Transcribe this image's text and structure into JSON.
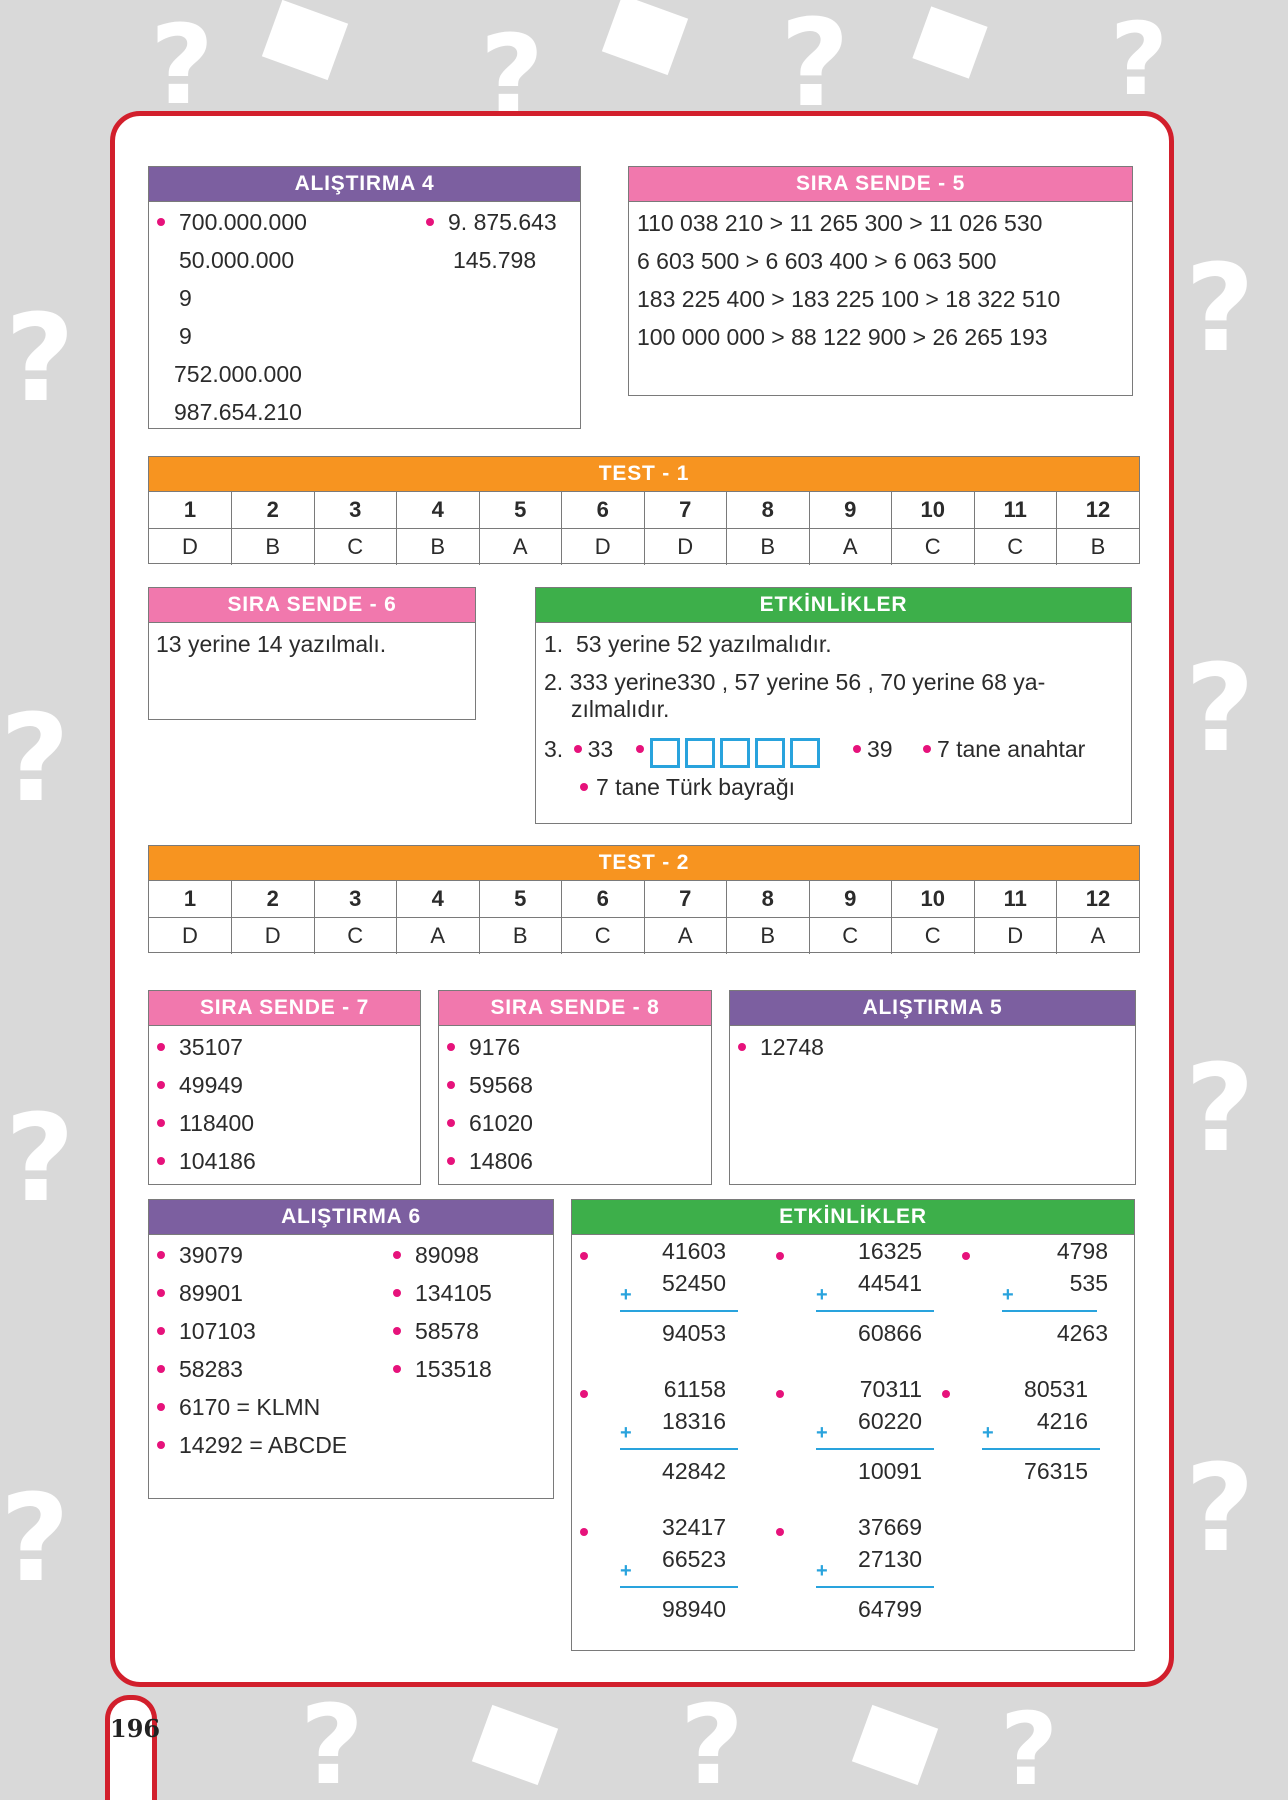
{
  "page_number": "196",
  "alistirma4": {
    "title": "ALIŞTIRMA 4",
    "col1": [
      "700.000.000",
      "50.000.000",
      "9",
      "9",
      "752.000.000",
      "987.654.210"
    ],
    "col2": [
      "9. 875.643",
      "145.798"
    ]
  },
  "sira5": {
    "title": "SIRA SENDE - 5",
    "lines": [
      "110 038 210 > 11 265 300 > 11 026 530",
      "6 603 500 > 6 603 400 > 6 063 500",
      "183 225 400 > 183 225 100 > 18 322 510",
      "100 000 000 > 88 122 900 > 26 265 193"
    ]
  },
  "test1": {
    "title": "TEST - 1",
    "numbers": [
      "1",
      "2",
      "3",
      "4",
      "5",
      "6",
      "7",
      "8",
      "9",
      "10",
      "11",
      "12"
    ],
    "answers": [
      "D",
      "B",
      "C",
      "B",
      "A",
      "D",
      "D",
      "B",
      "A",
      "C",
      "C",
      "B"
    ]
  },
  "sira6": {
    "title": "SIRA SENDE - 6",
    "text": "13 yerine 14 yazılmalı."
  },
  "etkinlikler1": {
    "title": "ETKİNLİKLER",
    "item1_num": "1.",
    "item1": "53 yerine 52 yazılmalıdır.",
    "item2_num": "2.",
    "item2_a": "333 yerine330 ,  57 yerine 56  , 70 yerine 68 ya-",
    "item2_b": "zılmalıdır.",
    "item3_num": "3.",
    "item3_a": "33",
    "item3_c": "39",
    "item3_d": "7 tane anahtar",
    "item3_e": "7 tane Türk bayrağı"
  },
  "test2": {
    "title": "TEST - 2",
    "numbers": [
      "1",
      "2",
      "3",
      "4",
      "5",
      "6",
      "7",
      "8",
      "9",
      "10",
      "11",
      "12"
    ],
    "answers": [
      "D",
      "D",
      "C",
      "A",
      "B",
      "C",
      "A",
      "B",
      "C",
      "C",
      "D",
      "A"
    ]
  },
  "sira7": {
    "title": "SIRA SENDE - 7",
    "items": [
      "35107",
      "49949",
      "118400",
      "104186"
    ]
  },
  "sira8": {
    "title": "SIRA SENDE - 8",
    "items": [
      "9176",
      "59568",
      "61020",
      "14806"
    ]
  },
  "alistirma5": {
    "title": "ALIŞTIRMA 5",
    "items": [
      "12748"
    ]
  },
  "alistirma6": {
    "title": "ALIŞTIRMA 6",
    "col1": [
      "39079",
      "89901",
      "107103",
      "58283",
      "6170 = KLMN",
      "14292 = ABCDE"
    ],
    "col2": [
      "89098",
      "134105",
      "58578",
      "153518"
    ]
  },
  "etkinlikler2": {
    "title": "ETKİNLİKLER",
    "plus": "+",
    "sums": [
      {
        "a": "41603",
        "b": "52450",
        "r": "94053"
      },
      {
        "a": "16325",
        "b": "44541",
        "r": "60866"
      },
      {
        "a": "4798",
        "b": "535",
        "r": "4263"
      },
      {
        "a": "61158",
        "b": "18316",
        "r": "42842"
      },
      {
        "a": "70311",
        "b": "60220",
        "r": "10091"
      },
      {
        "a": "80531",
        "b": "4216",
        "r": "76315"
      },
      {
        "a": "32417",
        "b": "66523",
        "r": "98940"
      },
      {
        "a": "37669",
        "b": "27130",
        "r": "64799"
      }
    ]
  }
}
